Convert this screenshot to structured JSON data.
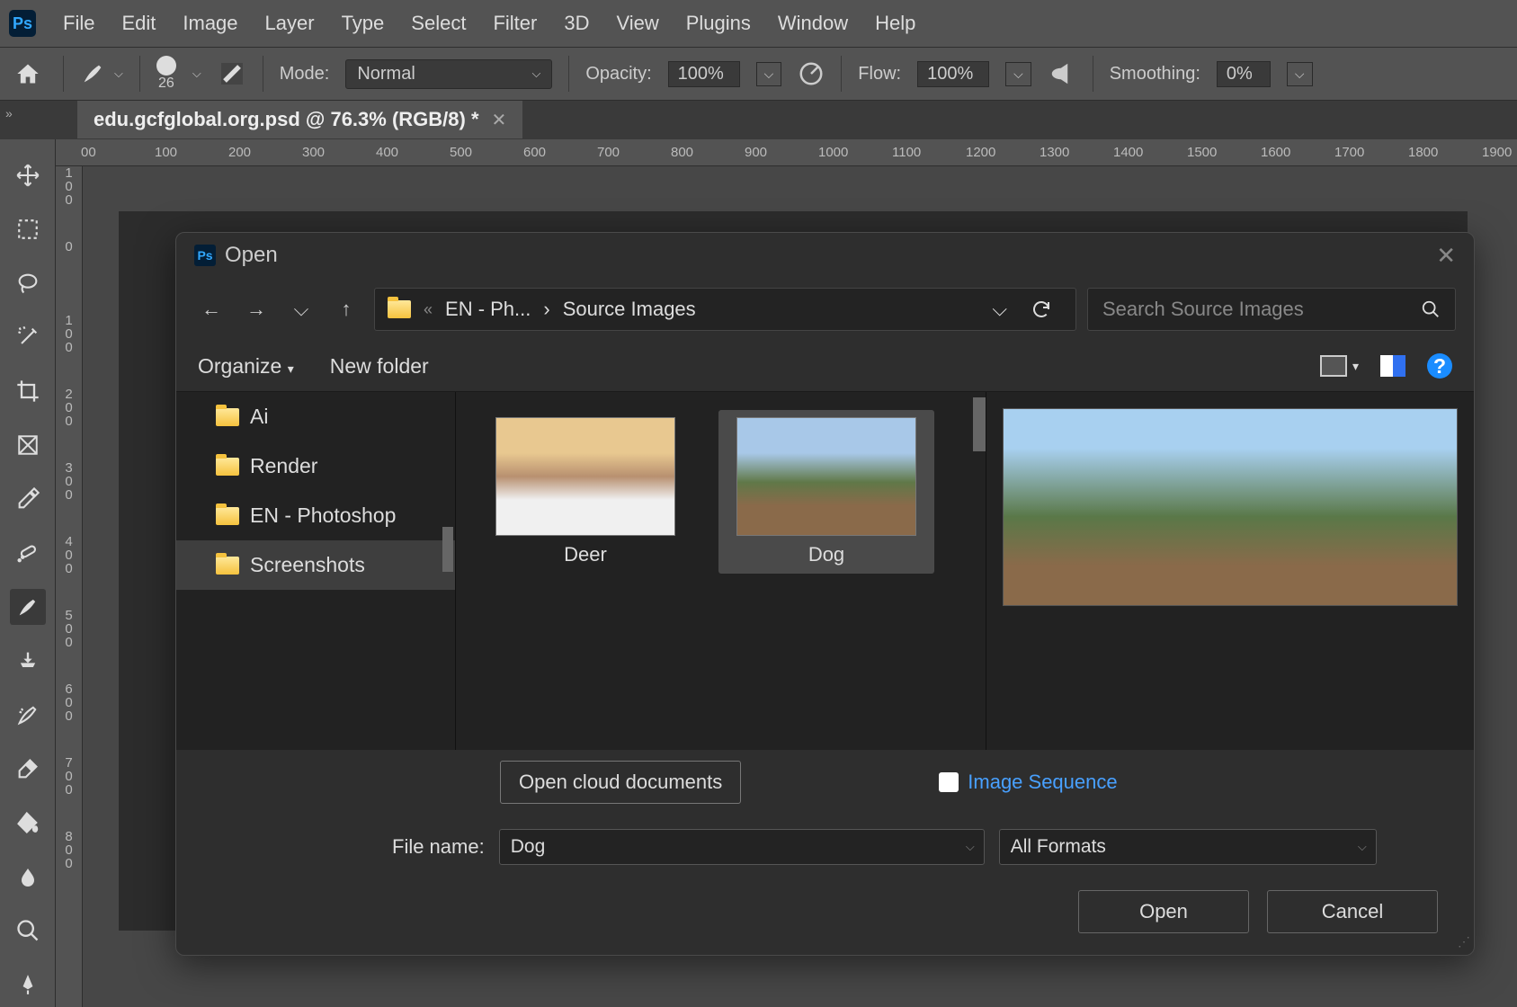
{
  "menubar": {
    "items": [
      "File",
      "Edit",
      "Image",
      "Layer",
      "Type",
      "Select",
      "Filter",
      "3D",
      "View",
      "Plugins",
      "Window",
      "Help"
    ]
  },
  "optionsbar": {
    "brush_size": "26",
    "mode_label": "Mode:",
    "mode_value": "Normal",
    "opacity_label": "Opacity:",
    "opacity_value": "100%",
    "flow_label": "Flow:",
    "flow_value": "100%",
    "smoothing_label": "Smoothing:",
    "smoothing_value": "0%"
  },
  "document_tab": {
    "title": "edu.gcfglobal.org.psd @ 76.3% (RGB/8) *"
  },
  "ruler_h": [
    "00",
    "100",
    "200",
    "300",
    "400",
    "500",
    "600",
    "700",
    "800",
    "900",
    "1000",
    "1100",
    "1200",
    "1300",
    "1400",
    "1500",
    "1600",
    "1700",
    "1800",
    "1900"
  ],
  "ruler_v": [
    "1\n0\n0",
    "0",
    "1\n0\n0",
    "2\n0\n0",
    "3\n0\n0",
    "4\n0\n0",
    "5\n0\n0",
    "6\n0\n0",
    "7\n0\n0",
    "8\n0\n0"
  ],
  "dialog": {
    "title": "Open",
    "breadcrumb": {
      "prefix": "«",
      "part1": "EN - Ph...",
      "part2": "Source Images"
    },
    "search_placeholder": "Search Source Images",
    "organize": "Organize",
    "new_folder": "New folder",
    "tree": [
      {
        "label": "Ai",
        "selected": false
      },
      {
        "label": "Render",
        "selected": false
      },
      {
        "label": "EN - Photoshop",
        "selected": false
      },
      {
        "label": "Screenshots",
        "selected": true
      }
    ],
    "files": [
      {
        "label": "Deer",
        "selected": false,
        "thumb": "deer"
      },
      {
        "label": "Dog",
        "selected": true,
        "thumb": "dog"
      }
    ],
    "cloud_button": "Open cloud documents",
    "image_sequence": "Image Sequence",
    "filename_label": "File name:",
    "filename_value": "Dog",
    "format_value": "All Formats",
    "open_btn": "Open",
    "cancel_btn": "Cancel"
  }
}
